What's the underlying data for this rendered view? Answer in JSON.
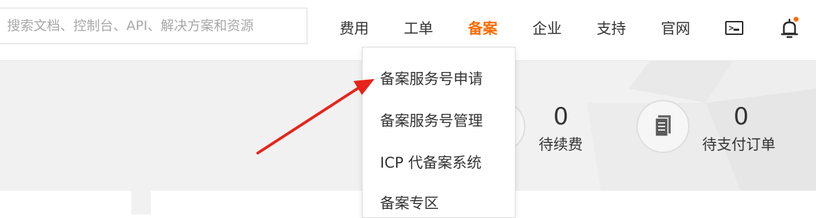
{
  "search": {
    "placeholder": "搜索文档、控制台、API、解决方案和资源"
  },
  "nav": {
    "items": [
      {
        "label": "费用"
      },
      {
        "label": "工单"
      },
      {
        "label": "备案"
      },
      {
        "label": "企业"
      },
      {
        "label": "支持"
      },
      {
        "label": "官网"
      }
    ],
    "active_index": 2,
    "icons": [
      "terminal-icon",
      "bell-icon"
    ]
  },
  "dropdown": {
    "items": [
      {
        "label": "备案服务号申请"
      },
      {
        "label": "备案服务号管理"
      },
      {
        "label": "ICP 代备案系统"
      },
      {
        "label": "备案专区"
      }
    ]
  },
  "stats": [
    {
      "value": "0",
      "label": "待续费"
    },
    {
      "value": "0",
      "label": "待支付订单",
      "icon": "document-icon"
    }
  ],
  "colors": {
    "accent": "#ff6a00",
    "annotation_arrow": "#e8231a",
    "background": "#f1f1f1"
  }
}
